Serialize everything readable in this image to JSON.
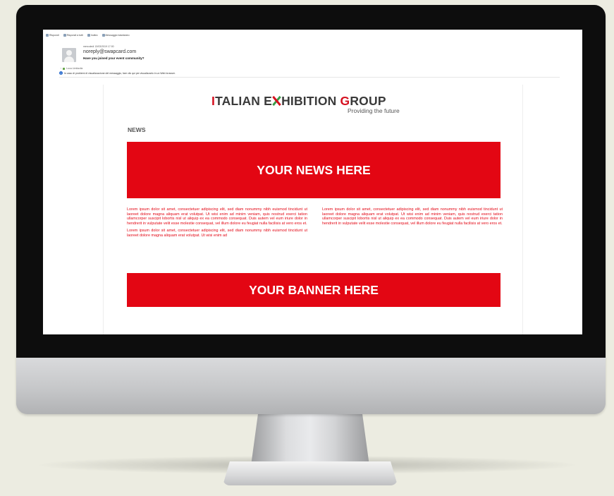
{
  "toolbar": {
    "items": [
      {
        "icon": "reply-icon",
        "label": "Rispondi"
      },
      {
        "icon": "reply-all-icon",
        "label": "Rispondi a tutti"
      },
      {
        "icon": "forward-icon",
        "label": "Inoltra"
      },
      {
        "icon": "chat-icon",
        "label": "Messaggio istantaneo"
      }
    ]
  },
  "email": {
    "date": "mercoledì 13/03/2019 17:00",
    "from": "noreply@swapcard.com",
    "subject": "Have you joined your event community?",
    "to": "Luca Limitavila",
    "info_bar": "In caso di problemi di visualizzazione del messaggio, fare clic qui per visualizzarlo in un Web browser."
  },
  "newsletter": {
    "logo": {
      "part1_red": "I",
      "part1": "TALIAN E",
      "part2": "HIBITION ",
      "part3_red": "G",
      "part3": "ROUP"
    },
    "tagline": "Providing the future",
    "section_label": "NEWS",
    "news_box": "YOUR NEWS HERE",
    "banner_box": "YOUR BANNER HERE",
    "columns": {
      "left_p1": "Lorem ipsum dolor sit amet, consectetuer adipiscing elit, sed diam nonummy nibh euismod tincidunt ut laoreet dolore magna aliquam erat volutpat. Ut wisi enim ad minim veniam, quis nostrud exerci tation ullamcorper suscipit lobortis nisl ut aliquip ex ea commodo consequat. Duis autem vel eum iriure dolor in hendrerit in vulputate velit esse molestie consequat, vel illum dolore eu feugiat nulla facilisis at vero eros et.",
      "left_p2": "Lorem ipsum dolor sit amet, consectetuer adipiscing elit, sed diam nonummy nibh euismod tincidunt ut laoreet dolore magna aliquam erat volutpat. Ut wisi enim ad",
      "right_p1": "Lorem ipsum dolor sit amet, consectetuer adipiscing elit, sed diam nonummy nibh euismod tincidunt ut laoreet dolore magna aliquam erat volutpat. Ut wisi enim ad minim veniam, quis nostrud exerci tation ullamcorper suscipit lobortis nisl ut aliquip ex ea commodo consequat. Duis autem vel eum iriure dolor in hendrerit in vulputate velit esse molestie consequat, vel illum dolore eu feugiat nulla facilisis at vero eros et."
    }
  },
  "colors": {
    "brand_red": "#e30613",
    "logo_green": "#3a9b4a",
    "logo_text": "#3a3a3a",
    "background": "#ecece1"
  }
}
